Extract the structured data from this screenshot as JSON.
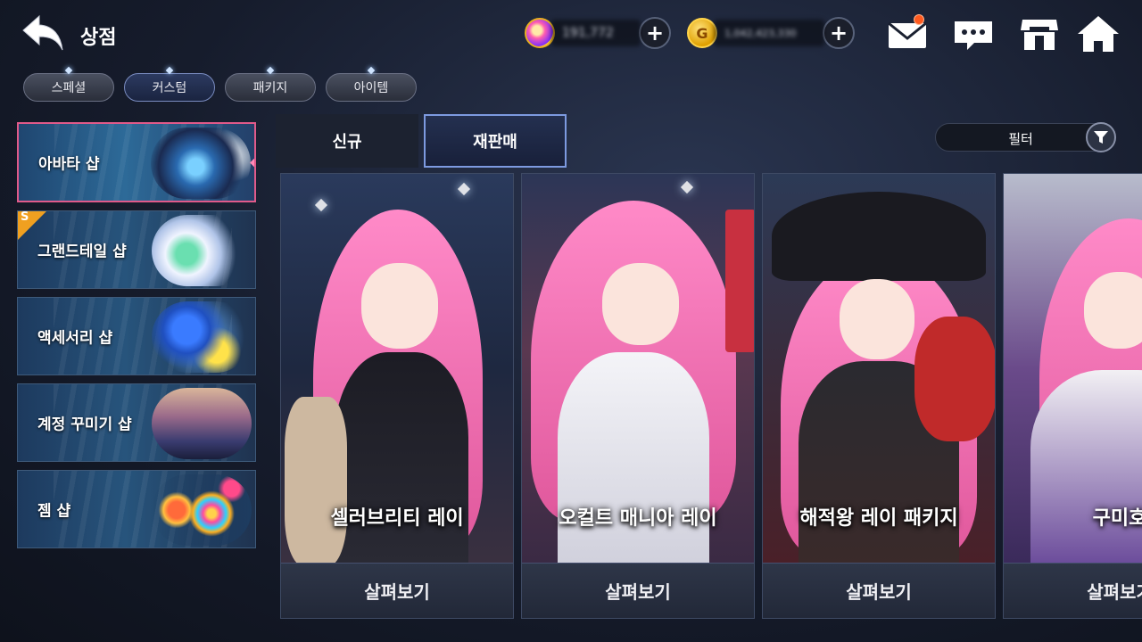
{
  "header": {
    "title": "상점",
    "gem_balance": "191,772",
    "gold_balance": "1,042,423,330",
    "gold_symbol": "G"
  },
  "main_tabs": [
    {
      "label": "스페셜",
      "active": false
    },
    {
      "label": "커스텀",
      "active": true
    },
    {
      "label": "패키지",
      "active": false
    },
    {
      "label": "아이템",
      "active": false
    }
  ],
  "sidebar": {
    "badge_letter": "S",
    "items": [
      {
        "label": "아바타 샵",
        "selected": true
      },
      {
        "label": "그랜드테일 샵",
        "selected": false
      },
      {
        "label": "액세서리 샵",
        "selected": false
      },
      {
        "label": "계정 꾸미기 샵",
        "selected": false
      },
      {
        "label": "젬 샵",
        "selected": false
      }
    ]
  },
  "sub_tabs": [
    {
      "label": "신규",
      "active": false
    },
    {
      "label": "재판매",
      "active": true
    }
  ],
  "filter": {
    "label": "필터"
  },
  "products": [
    {
      "name": "셀러브리티 레이",
      "button": "살펴보기"
    },
    {
      "name": "오컬트 매니아 레이",
      "button": "살펴보기"
    },
    {
      "name": "해적왕 레이 패키지",
      "button": "살펴보기"
    },
    {
      "name": "구미호",
      "button": "살펴보기"
    }
  ],
  "colors": {
    "accent_selected": "#e05a8a",
    "active_tab_border": "#7d9ae0",
    "notification": "#ff5a1f",
    "gold": "#e0a000"
  }
}
